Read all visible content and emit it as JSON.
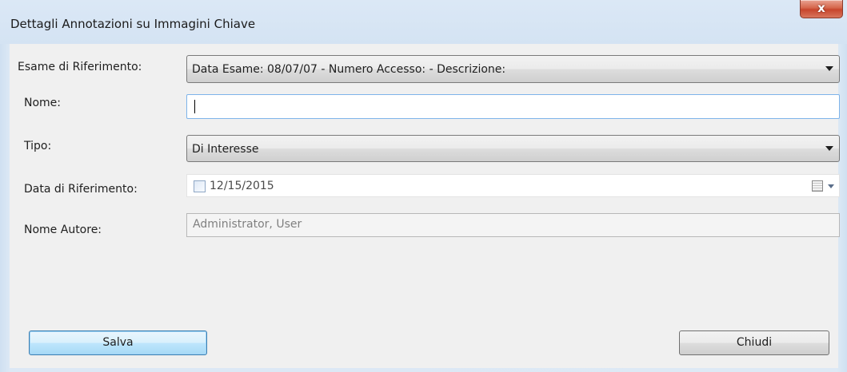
{
  "window": {
    "title": "Dettagli Annotazioni su Immagini Chiave",
    "close_glyph": "x",
    "close_icon": "close-icon"
  },
  "form": {
    "exam": {
      "label": "Esame di Riferimento:",
      "value": "Data Esame: 08/07/07 - Numero Accesso:  - Descrizione:"
    },
    "name": {
      "label": "Nome:",
      "value": ""
    },
    "type": {
      "label": "Tipo:",
      "value": "Di Interesse"
    },
    "reference_date": {
      "label": "Data di Riferimento:",
      "value": "12/15/2015",
      "checked": false
    },
    "author": {
      "label": "Nome Autore:",
      "value": "Administrator, User"
    }
  },
  "buttons": {
    "save": "Salva",
    "close": "Chiudi"
  },
  "colors": {
    "client_bg": "#f0f0f0",
    "frame": "#d4e3f3",
    "default_button_border": "#3c7fb1",
    "close_button": "#c7452c"
  }
}
